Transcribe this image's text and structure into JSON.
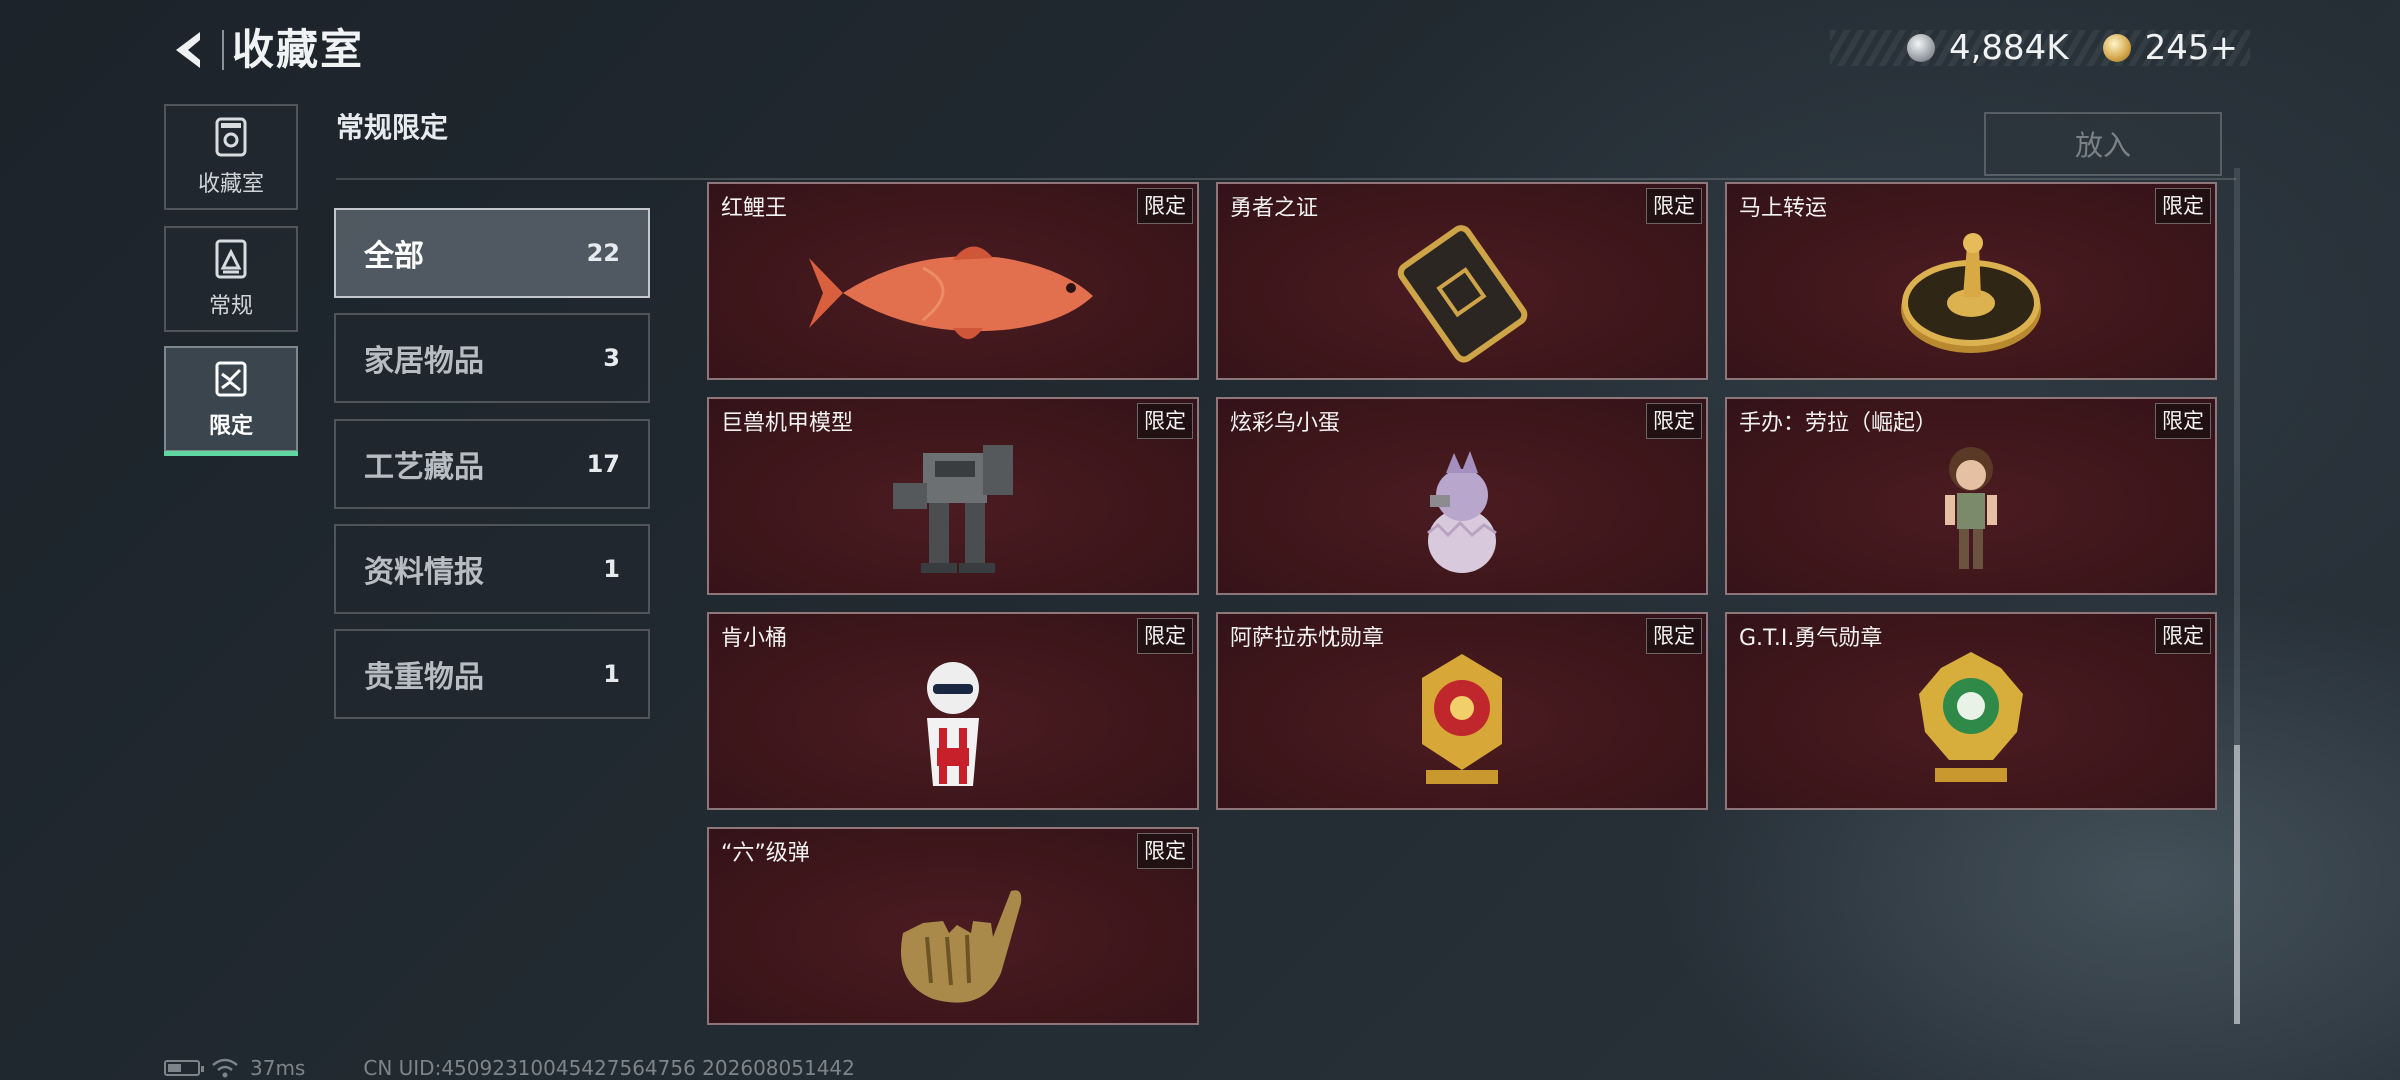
{
  "header": {
    "title": "收藏室",
    "currencies": [
      {
        "icon": "silver-coin-icon",
        "value": "4,884K"
      },
      {
        "icon": "gold-coin-icon",
        "value": "245+"
      }
    ]
  },
  "nav": {
    "items": [
      {
        "label": "收藏室",
        "icon": "collection-room-icon",
        "active": false
      },
      {
        "label": "常规",
        "icon": "regular-icon",
        "active": false
      },
      {
        "label": "限定",
        "icon": "limited-icon",
        "active": true
      }
    ]
  },
  "section": {
    "title": "常规限定",
    "put_in_label": "放入"
  },
  "categories": [
    {
      "label": "全部",
      "count": "22",
      "active": true
    },
    {
      "label": "家居物品",
      "count": "3"
    },
    {
      "label": "工艺藏品",
      "count": "17"
    },
    {
      "label": "资料情报",
      "count": "1"
    },
    {
      "label": "贵重物品",
      "count": "1"
    }
  ],
  "items": [
    {
      "name": "红鲤王",
      "badge": "限定",
      "art": "red-carp-icon"
    },
    {
      "name": "勇者之证",
      "badge": "限定",
      "art": "gold-card-icon"
    },
    {
      "name": "马上转运",
      "badge": "限定",
      "art": "gold-wheel-icon"
    },
    {
      "name": "巨兽机甲模型",
      "badge": "限定",
      "art": "mech-model-icon"
    },
    {
      "name": "炫彩乌小蛋",
      "badge": "限定",
      "art": "egg-figure-icon"
    },
    {
      "name": "手办：劳拉（崛起）",
      "badge": "限定",
      "art": "lara-figure-icon"
    },
    {
      "name": "肯小桶",
      "badge": "限定",
      "art": "bucket-figure-icon"
    },
    {
      "name": "阿萨拉赤忱勋章",
      "badge": "限定",
      "art": "red-medal-icon"
    },
    {
      "name": "G.T.I.勇气勋章",
      "badge": "限定",
      "art": "green-medal-icon"
    },
    {
      "name": "“六”级弹",
      "badge": "限定",
      "art": "gold-hand-icon"
    }
  ],
  "footer": {
    "ping": "37ms",
    "uid": "CN UID:45092310045427564756 202608051442"
  },
  "colors": {
    "accent_green": "#5ed7a0",
    "card_bg": "#3b1519"
  }
}
